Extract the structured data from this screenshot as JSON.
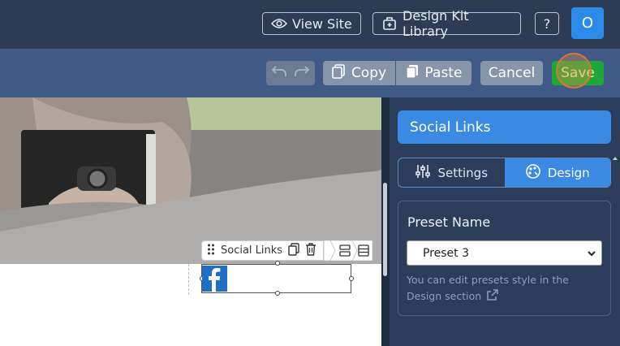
{
  "topbar": {
    "view_site": "View Site",
    "design_kit": "Design Kit Library",
    "help": "?",
    "avatar": "O"
  },
  "toolbar": {
    "copy": "Copy",
    "paste": "Paste",
    "cancel": "Cancel",
    "save": "Save"
  },
  "widget": {
    "label": "Social Links"
  },
  "panel": {
    "title": "Social Links",
    "tabs": [
      {
        "label": "Settings",
        "active": false
      },
      {
        "label": "Design",
        "active": true
      }
    ],
    "preset_label": "Preset Name",
    "preset_value": "Preset 3",
    "hint": "You can edit presets style in the Design section"
  },
  "colors": {
    "accent": "#3a8ae3",
    "save_green": "#1fa83a",
    "facebook": "#1f6fc2"
  }
}
